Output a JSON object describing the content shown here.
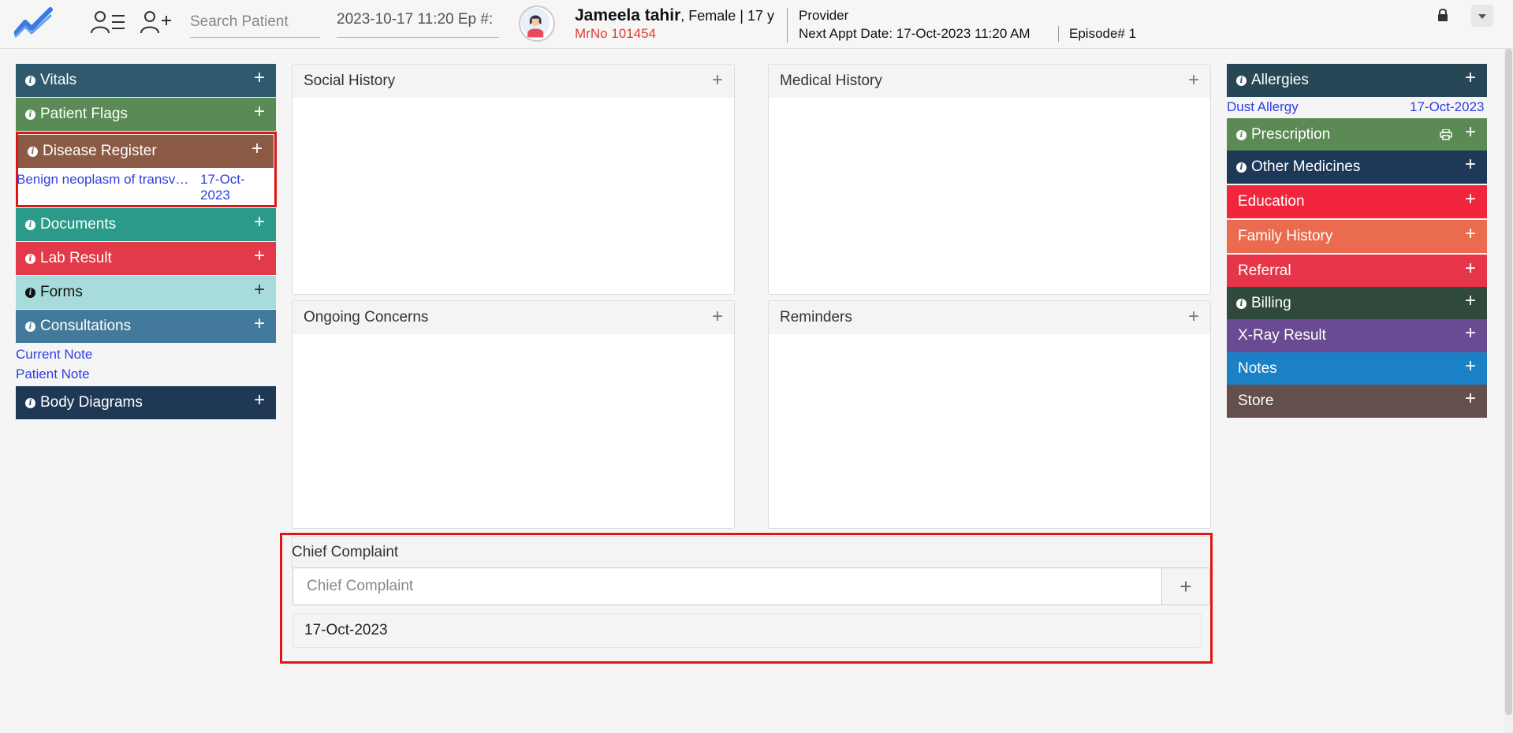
{
  "topbar": {
    "search_placeholder": "Search Patient",
    "episode_text": "2023-10-17 11:20 Ep #:",
    "patient_name": "Jameela tahir",
    "patient_details": ", Female | 17 y",
    "mrno": "MrNo 101454",
    "provider": "Provider",
    "next_appt": "Next Appt Date: 17-Oct-2023 11:20 AM",
    "episode": "Episode# 1"
  },
  "left": {
    "vitals": "Vitals",
    "flags": "Patient Flags",
    "disease": "Disease Register",
    "disease_item": "Benign neoplasm of transv…",
    "disease_date_1": "17-Oct-",
    "disease_date_2": "2023",
    "documents": "Documents",
    "lab": "Lab Result",
    "forms": "Forms",
    "consultations": "Consultations",
    "current_note": "Current Note",
    "patient_note": "Patient Note",
    "body": "Body Diagrams"
  },
  "center": {
    "social": "Social History",
    "medical": "Medical History",
    "ongoing": "Ongoing Concerns",
    "reminders": "Reminders",
    "chief_title": "Chief Complaint",
    "chief_placeholder": "Chief Complaint",
    "chief_date": "17-Oct-2023"
  },
  "right": {
    "allergies": "Allergies",
    "allergy_item": "Dust Allergy",
    "allergy_date": "17-Oct-2023",
    "prescription": "Prescription",
    "other_medicines": "Other Medicines",
    "education": "Education",
    "family": "Family History",
    "referral": "Referral",
    "billing": "Billing",
    "xray": "X-Ray Result",
    "notes": "Notes",
    "store": "Store"
  },
  "icons": {
    "plus": "+",
    "info": "i"
  },
  "colors": {
    "vitals": "#2f5a6e",
    "flags": "#5a8a55",
    "disease": "#8a5a44",
    "documents": "#2b9a8a",
    "lab": "#e23a48",
    "forms": "#a8dcdc",
    "consultations": "#43799a",
    "body": "#1e3856",
    "allergies": "#274756",
    "prescription": "#5b8a55",
    "other_medicines": "#1e3858",
    "education": "#f1263d",
    "family": "#ea6b4e",
    "referral": "#e63448",
    "billing": "#2f4a3d",
    "xray": "#6a4a92",
    "notes": "#1b81c6",
    "store": "#644e4e",
    "highlight": "#e01515",
    "link": "#2d3ee0"
  }
}
